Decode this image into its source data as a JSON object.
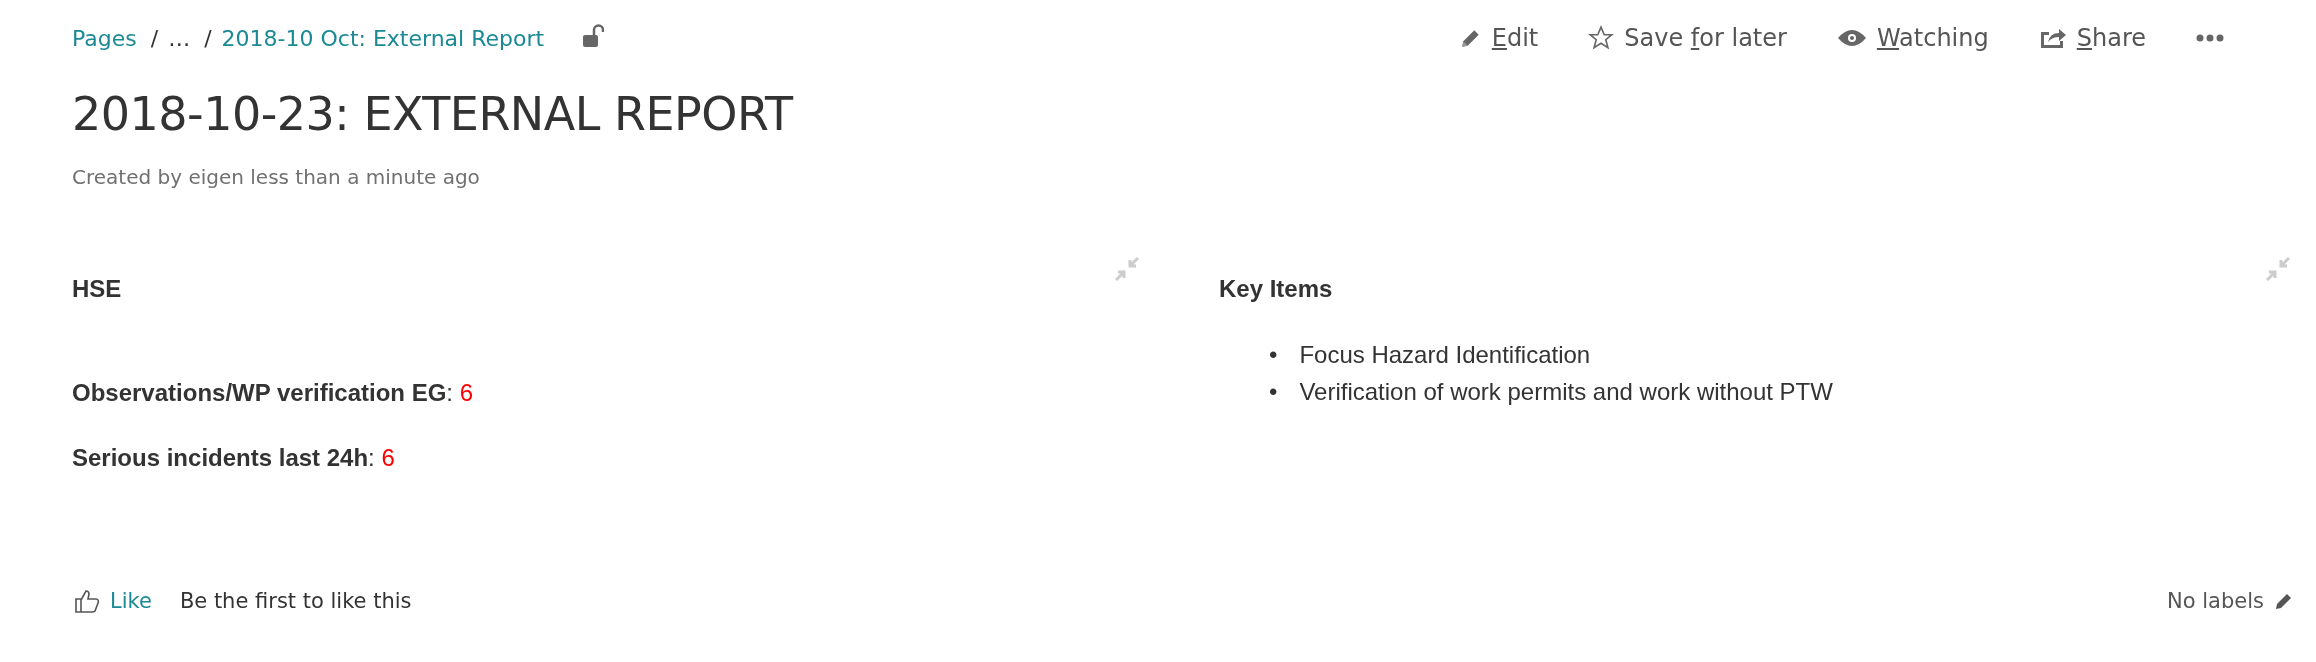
{
  "breadcrumbs": [
    {
      "kind": "link",
      "label": "Pages"
    },
    {
      "kind": "text",
      "separator": "/",
      "label": "…"
    },
    {
      "kind": "link",
      "separator": "/",
      "label": "2018-10 Oct: External Report"
    }
  ],
  "restrictions": {
    "locked": false
  },
  "actions": [
    {
      "kind": "edit",
      "label_parts": [
        {
          "text": "E",
          "underlined": true
        },
        {
          "text": "dit",
          "underlined": false
        }
      ]
    },
    {
      "kind": "save",
      "label_parts": [
        {
          "text": "Save ",
          "underlined": false
        },
        {
          "text": "f",
          "underlined": true
        },
        {
          "text": "or later",
          "underlined": false
        }
      ]
    },
    {
      "kind": "watch",
      "label_parts": [
        {
          "text": "W",
          "underlined": true
        },
        {
          "text": "atching",
          "underlined": false
        }
      ]
    },
    {
      "kind": "share",
      "label_parts": [
        {
          "text": "S",
          "underlined": true
        },
        {
          "text": "hare",
          "underlined": false
        }
      ]
    },
    {
      "kind": "more"
    }
  ],
  "title": "2018-10-23: EXTERNAL REPORT",
  "byline": "Created by eigen less than a minute ago",
  "sections": [
    {
      "kind": "fields",
      "heading": "HSE",
      "fields": [
        {
          "label": "Observations/WP verification EG",
          "separator": ":",
          "value": "6"
        },
        {
          "label": "Serious incidents last 24h",
          "separator": ":",
          "value": "6"
        }
      ]
    },
    {
      "kind": "list",
      "heading": "Key Items",
      "items": [
        {
          "marker": "•",
          "text": "Focus Hazard Identification"
        },
        {
          "marker": "•",
          "text": "Verification of work permits and work without PTW"
        }
      ]
    }
  ],
  "footer": {
    "like": "Like",
    "like_summary": "Be the first to like this",
    "labels": "No labels"
  }
}
